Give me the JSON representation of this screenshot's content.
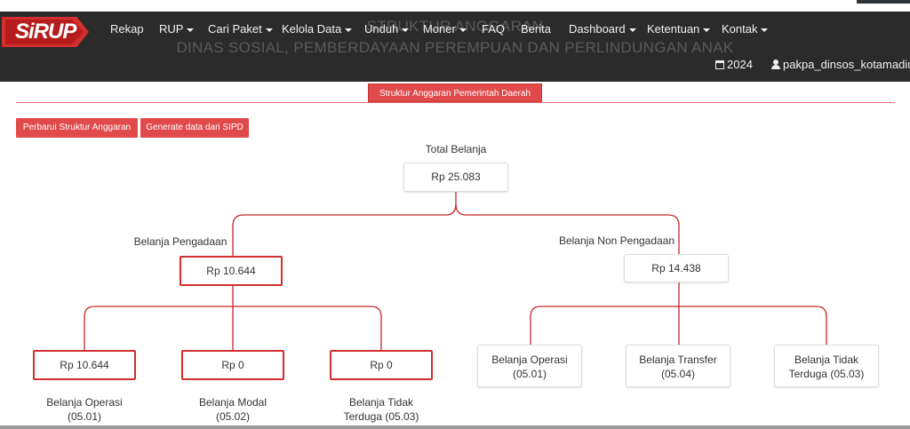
{
  "navbar": {
    "logo_text": "SiRUP",
    "ghost_title_1": "STRUKTUR ANGGARAN",
    "ghost_title_2": "DINAS SOSIAL, PEMBERDAYAAN PEREMPUAN DAN PERLINDUNGAN ANAK",
    "menu": [
      {
        "label": "Rekap",
        "dropdown": false
      },
      {
        "label": "RUP",
        "dropdown": true
      },
      {
        "label": "Cari Paket",
        "dropdown": true
      },
      {
        "label": "Kelola Data",
        "dropdown": true
      },
      {
        "label": "Unduh",
        "dropdown": true
      },
      {
        "label": "Moner",
        "dropdown": true
      },
      {
        "label": "FAQ",
        "dropdown": false
      },
      {
        "label": "Berita",
        "dropdown": false
      },
      {
        "label": "Dashboard",
        "dropdown": true
      },
      {
        "label": "Ketentuan",
        "dropdown": true
      },
      {
        "label": "Kontak",
        "dropdown": true
      }
    ],
    "year": "2024",
    "user": "pakpa_dinsos_kotamadiun"
  },
  "tab": {
    "label": "Struktur Anggaran Pemerintah Daerah"
  },
  "actions": {
    "refresh_label": "Perbarui Struktur Anggaran",
    "generate_label": "Generate data dari SIPD"
  },
  "tree": {
    "root": {
      "label": "Total Belanja",
      "value": "Rp 25.083"
    },
    "pengadaan": {
      "label": "Belanja Pengadaan",
      "value": "Rp 10.644"
    },
    "non_pengadaan": {
      "label": "Belanja Non Pengadaan",
      "value": "Rp 14.438"
    },
    "pengadaan_children": [
      {
        "value": "Rp 10.644",
        "label_1": "Belanja Operasi",
        "label_2": "(05.01)"
      },
      {
        "value": "Rp 0",
        "label_1": "Belanja Modal",
        "label_2": "(05.02)"
      },
      {
        "value": "Rp 0",
        "label_1": "Belanja Tidak",
        "label_2": "Terduga (05.03)"
      }
    ],
    "non_pengadaan_children": [
      {
        "label_1": "Belanja Operasi",
        "label_2": "(05.01)"
      },
      {
        "label_1": "Belanja Transfer",
        "label_2": "(05.04)"
      },
      {
        "label_1": "Belanja Tidak",
        "label_2": "Terduga (05.03)"
      }
    ]
  },
  "colors": {
    "accent": "#d32f2f",
    "navbar": "#2b2b2b",
    "button": "#e04a4a"
  }
}
